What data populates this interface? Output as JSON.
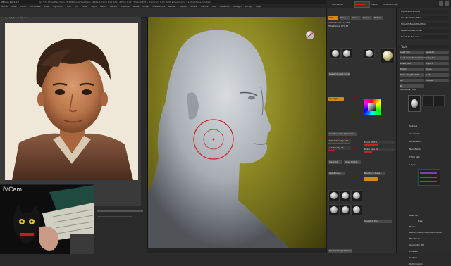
{
  "app": {
    "title": "ZBrush 2022.0.7",
    "title_extra": "QS 577.936 ▸ Free Mem 36.968GB ▸ Active Mem 2440 ▸ Scratch Disk 124 ▸ ZTime 0.015 Timer 0.895 ▸ PolyCount 9.40 TK KP ▸ MeshCount 1 ▸ QuickSave In 1 Secs"
  },
  "menubar": {
    "items": [
      "Alpha",
      "Brush",
      "Color",
      "Document",
      "Draw",
      "Dynamics",
      "Edit",
      "File",
      "Layer",
      "Light",
      "Macro",
      "Marker",
      "Material",
      "Movie",
      "Picker",
      "Preferences",
      "Render",
      "Stencil",
      "Stroke",
      "Texture",
      "Tool",
      "Transform",
      "Zplugin",
      "Zscript",
      "Help"
    ]
  },
  "header_right": {
    "quicksave": "QuickSave",
    "see_through": "See-through 0",
    "menus": "Menus",
    "default_script": "DefaultZScript"
  },
  "reference_panel": {
    "caption": "1_1.97_5.9, 2.00, 4.0"
  },
  "webcam": {
    "label": "iVCam"
  },
  "tool_palette": {
    "mode_tabs": [
      "Edit",
      "Draw",
      "Move",
      "Scale",
      "Rotate"
    ],
    "active_tab": "Edit",
    "points": "ActivePoints: 12,466",
    "total": "TotalPoints: 677,73",
    "buttons": [
      "Reset Current Brush",
      "Spotlight",
      "Bk Intensity 100",
      "Clear All",
      "Clear Higher",
      "LazyMouse",
      "Backface Mask",
      "Use Poseable Symmetry",
      "Sculptris Pro",
      "Mask Changed Points"
    ],
    "labels": [
      "Focal Shift 0",
      "Draw Size 64",
      "Dynamic",
      "RGB Intensity 100",
      "Z Intensity 25"
    ],
    "accent": "#d48a10",
    "slider_color": "#c82020"
  },
  "subtool_panel": {
    "top_items": [
      "Alpha and Texture",
      "Clip Brush Modifiers",
      "Smooth Brush Modifiers",
      "Reset Current Brush",
      "Reset All Brushes"
    ],
    "tool_header": "Tool",
    "tool_buttons": [
      "Load Tool",
      "Save As",
      "Load Tools From Project",
      "Copy Tool",
      "Paste Tool",
      "Import",
      "Export",
      "Clone",
      "Make PolyMesh3D",
      "GoZ",
      "All",
      "Visible",
      "R"
    ],
    "lightbox": "Lightbox ▸ Tools",
    "menus": [
      "Subtool",
      "Geometry",
      "ArrayMesh",
      "NanoMesh",
      "Thick Skin",
      "Layers",
      "FiberMesh",
      "Geometry HD",
      "Preview",
      "Surface",
      "Deformation",
      "Masking",
      "Visibility",
      "Polygroups",
      "Contact",
      "Morph Target",
      "Polypaint",
      "UV Map",
      "Texture Map",
      "Displacement Map",
      "Normal Map",
      "Vector Displacement Map",
      "Display Properties",
      "Unified Skin",
      "Initialize",
      "Import",
      "Export"
    ],
    "bake": "Bake All",
    "new": "New",
    "name": "Name",
    "record": "Record Deformation Animation",
    "brush_names": [
      "Simple Brush",
      "Cylinder PolyMesh",
      "Simple Sphere"
    ]
  },
  "viewport": {
    "background": "#8e8a24",
    "brush_ring_color": "#d02020"
  }
}
